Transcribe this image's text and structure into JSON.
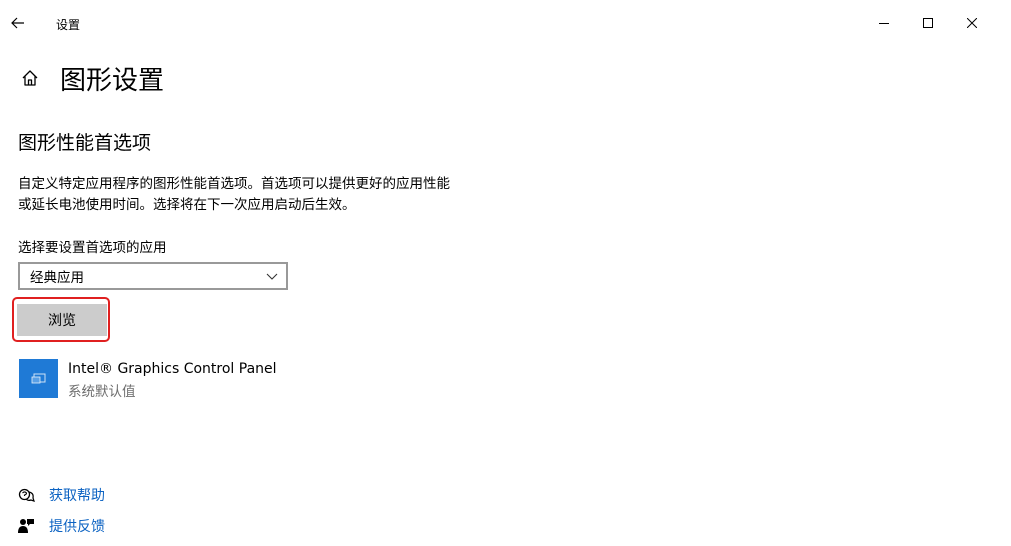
{
  "window": {
    "title": "设置",
    "controls": [
      "minimize",
      "maximize",
      "close"
    ]
  },
  "header": {
    "page_title": "图形设置",
    "home_icon": "home-icon"
  },
  "section": {
    "title": "图形性能首选项",
    "description": "自定义特定应用程序的图形性能首选项。首选项可以提供更好的应用性能或延长电池使用时间。选择将在下一次应用启动后生效。"
  },
  "app_select": {
    "label": "选择要设置首选项的应用",
    "selected_value": "经典应用",
    "browse_label": "浏览"
  },
  "apps": [
    {
      "name": "Intel® Graphics Control Panel",
      "status": "系统默认值",
      "icon_color": "#1f7ad6"
    }
  ],
  "links": {
    "help": "获取帮助",
    "feedback": "提供反馈"
  },
  "colors": {
    "accent_link": "#0b62c2",
    "highlight": "#e02020",
    "button_bg": "#cccccc"
  }
}
